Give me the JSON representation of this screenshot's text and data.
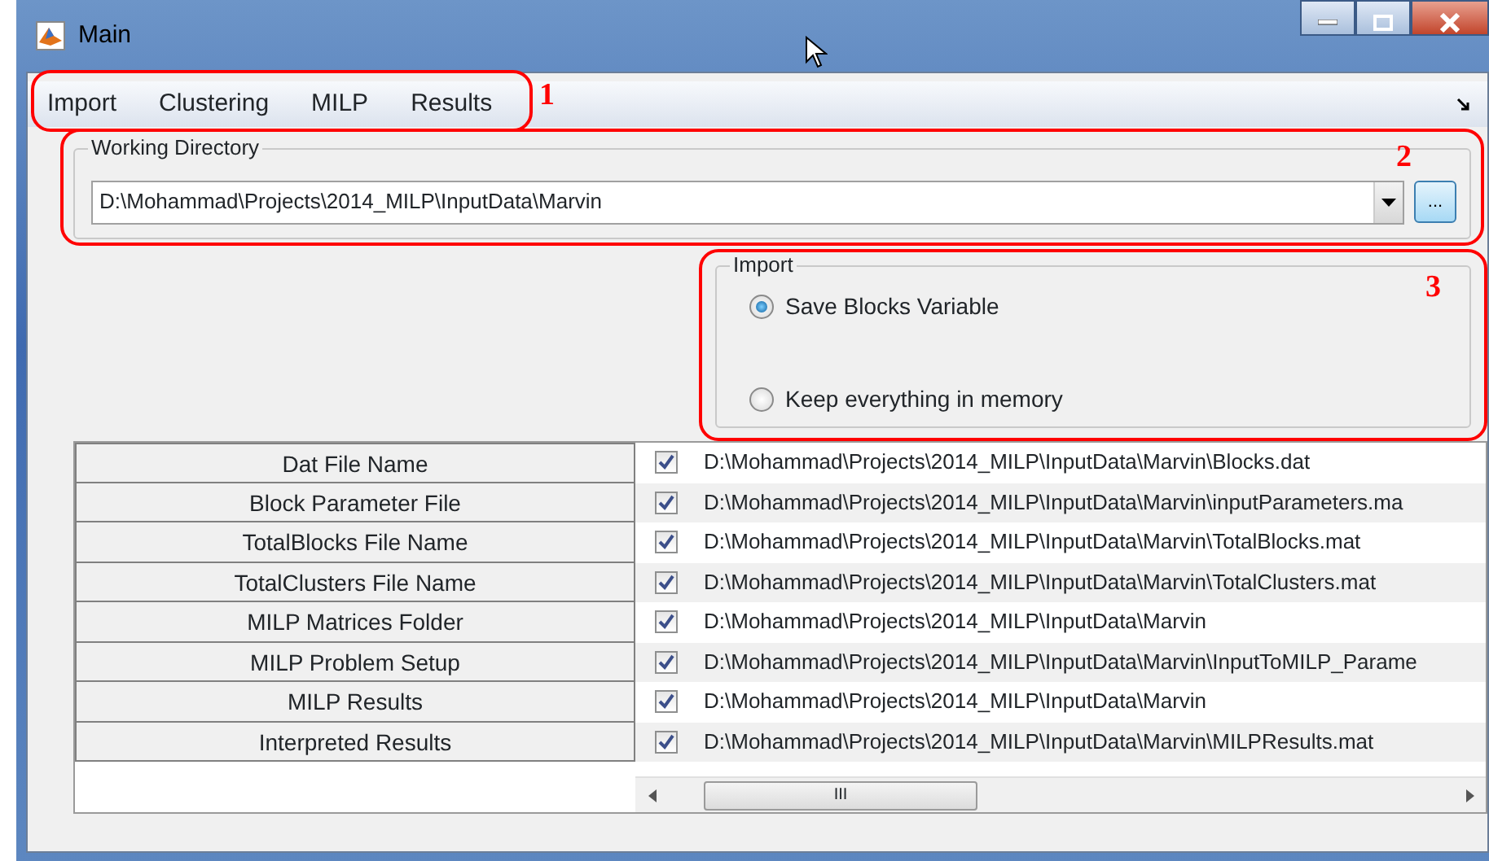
{
  "window": {
    "title": "Main"
  },
  "menu": [
    {
      "label": "Import"
    },
    {
      "label": "Clustering"
    },
    {
      "label": "MILP"
    },
    {
      "label": "Results"
    }
  ],
  "working_directory": {
    "label": "Working Directory",
    "value": "D:\\Mohammad\\Projects\\2014_MILP\\InputData\\Marvin",
    "browse_label": "..."
  },
  "import": {
    "label": "Import",
    "options": [
      {
        "label": "Save Blocks Variable",
        "selected": true
      },
      {
        "label": "Keep everything in memory",
        "selected": false
      }
    ]
  },
  "table": {
    "rows": [
      {
        "name": "Dat File Name",
        "checked": true,
        "path": "D:\\Mohammad\\Projects\\2014_MILP\\InputData\\Marvin\\Blocks.dat"
      },
      {
        "name": "Block Parameter File",
        "checked": true,
        "path": "D:\\Mohammad\\Projects\\2014_MILP\\InputData\\Marvin\\inputParameters.ma"
      },
      {
        "name": "TotalBlocks File Name",
        "checked": true,
        "path": "D:\\Mohammad\\Projects\\2014_MILP\\InputData\\Marvin\\TotalBlocks.mat"
      },
      {
        "name": "TotalClusters File Name",
        "checked": true,
        "path": "D:\\Mohammad\\Projects\\2014_MILP\\InputData\\Marvin\\TotalClusters.mat"
      },
      {
        "name": "MILP Matrices Folder",
        "checked": true,
        "path": "D:\\Mohammad\\Projects\\2014_MILP\\InputData\\Marvin"
      },
      {
        "name": "MILP Problem Setup",
        "checked": true,
        "path": "D:\\Mohammad\\Projects\\2014_MILP\\InputData\\Marvin\\InputToMILP_Parame"
      },
      {
        "name": "MILP Results",
        "checked": true,
        "path": "D:\\Mohammad\\Projects\\2014_MILP\\InputData\\Marvin"
      },
      {
        "name": "Interpreted Results",
        "checked": true,
        "path": "D:\\Mohammad\\Projects\\2014_MILP\\InputData\\Marvin\\MILPResults.mat"
      }
    ],
    "scroll_grip": "III"
  },
  "annotations": [
    "1",
    "2",
    "3"
  ]
}
